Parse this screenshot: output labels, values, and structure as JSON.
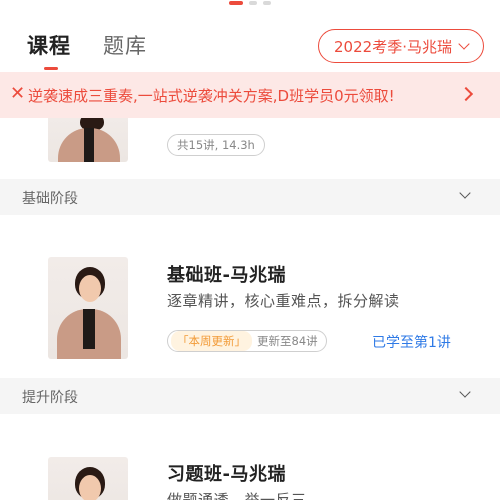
{
  "tabs": [
    {
      "label": "课程",
      "active": true
    },
    {
      "label": "题库",
      "active": false
    }
  ],
  "term_selector": {
    "label": "2022考季·马兆瑞"
  },
  "banner": {
    "close_glyph": "✕",
    "text": "逆袭速成三重奏,一站式逆袭冲关方案,D班学员0元领取!"
  },
  "top_course": {
    "meta": "共15讲, 14.3h"
  },
  "sections": [
    {
      "label": "基础阶段",
      "course": {
        "title": "基础班-马兆瑞",
        "desc": "逐章精讲，核心重难点，拆分解读",
        "badge": "「本周更新」",
        "update": "更新至84讲",
        "progress": "已学至第1讲"
      }
    },
    {
      "label": "提升阶段",
      "course": {
        "title": "习题班-马兆瑞",
        "desc": "做题通透，举一反三"
      }
    }
  ],
  "colors": {
    "accent": "#ec4b3c",
    "link": "#2f7ae6",
    "badge": "#f29b38",
    "banner_bg": "#fde8e6"
  }
}
